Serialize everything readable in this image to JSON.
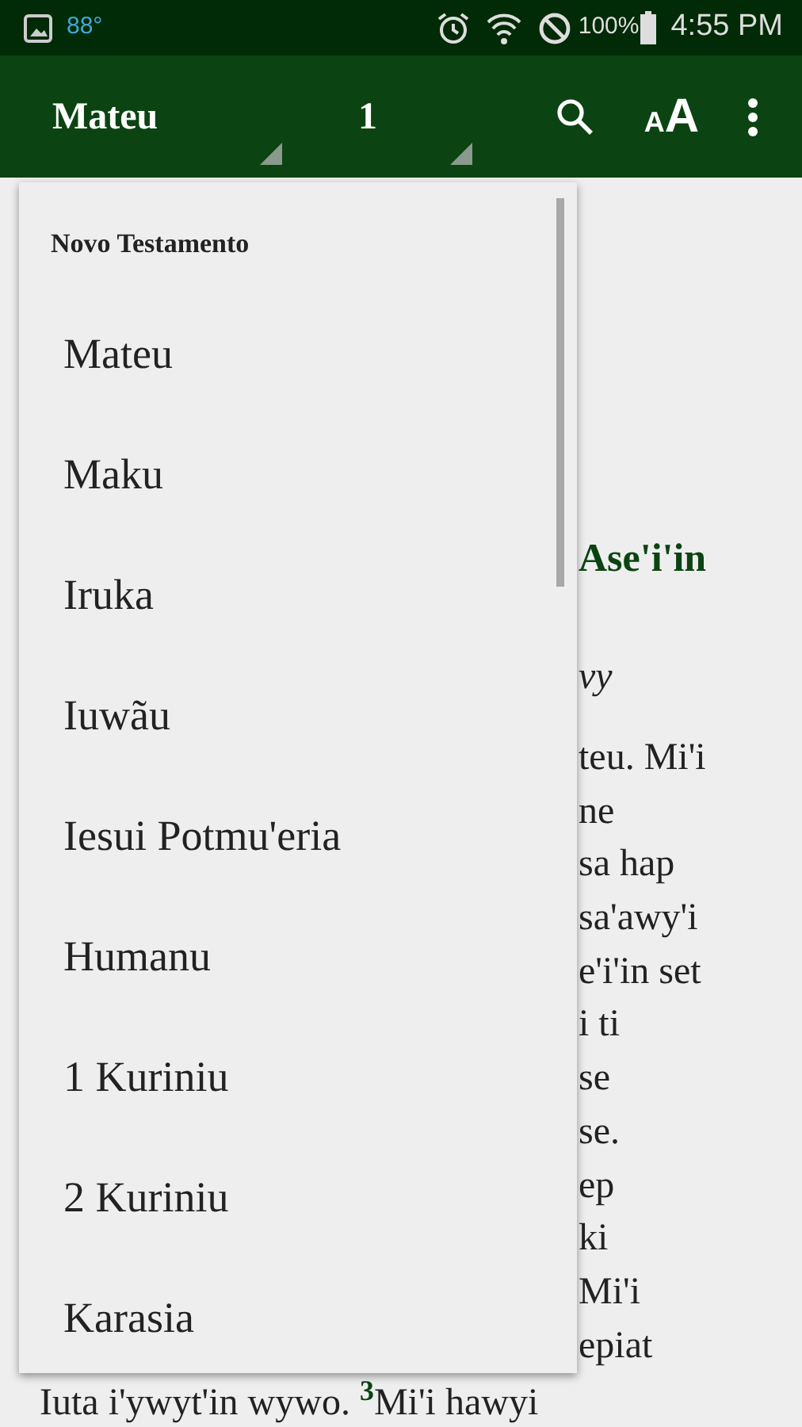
{
  "status_bar": {
    "temperature": "88°",
    "battery": "100%",
    "time": "4:55 PM"
  },
  "toolbar": {
    "book": "Mateu",
    "chapter": "1",
    "text_size": [
      "A",
      "A"
    ]
  },
  "content": {
    "heading": "Ase'i'in",
    "subtitle": "vy",
    "lines": [
      {
        "kind": "clipped",
        "text": "teu. Mi'i"
      },
      {
        "kind": "clipped",
        "text": "ne"
      },
      {
        "kind": "clipped",
        "text": "sa hap"
      },
      {
        "kind": "clipped",
        "text": "sa'awy'i"
      },
      {
        "kind": "clipped",
        "text": "e'i'in set"
      },
      {
        "kind": "clipped",
        "text": "i ti"
      },
      {
        "kind": "clipped",
        "text": "se"
      },
      {
        "kind": "clipped",
        "text": "se."
      },
      {
        "kind": "clipped",
        "text": "ep"
      },
      {
        "kind": "clipped",
        "text": "ki"
      },
      {
        "kind": "clipped",
        "text": "Mi'i"
      },
      {
        "kind": "clipped",
        "text": "epiat"
      },
      {
        "kind": "full",
        "text": "Iuta i'ywyt'in wywo. $^{3}$Mi'i hawyi"
      }
    ]
  },
  "book_menu": {
    "header": "Novo Testamento",
    "items": [
      "Mateu",
      "Maku",
      "Iruka",
      "Iuwãu",
      "Iesui Potmu'eria",
      "Humanu",
      "1 Kuriniu",
      "2 Kuriniu",
      "Karasia"
    ]
  }
}
